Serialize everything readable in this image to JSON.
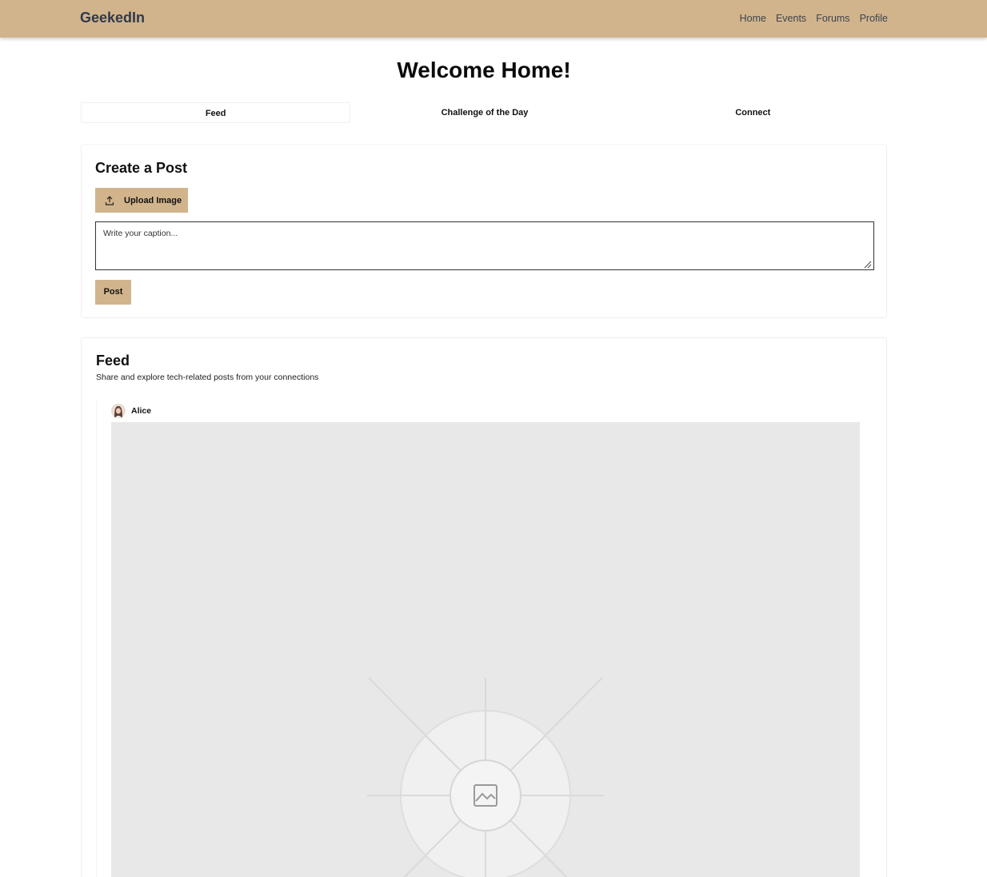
{
  "navbar": {
    "brand": "GeekedIn",
    "links": [
      "Home",
      "Events",
      "Forums",
      "Profile"
    ]
  },
  "page": {
    "heading": "Welcome Home!"
  },
  "tabs": [
    {
      "label": "Feed",
      "active": true
    },
    {
      "label": "Challenge of the Day",
      "active": false
    },
    {
      "label": "Connect",
      "active": false
    }
  ],
  "create_post": {
    "title": "Create a Post",
    "upload_label": "Upload Image",
    "upload_icon": "upload-icon",
    "caption_placeholder": "Write your caption...",
    "post_label": "Post"
  },
  "feed": {
    "title": "Feed",
    "subtitle": "Share and explore tech-related posts from your connections",
    "posts": [
      {
        "author": "Alice",
        "avatar_icon": "avatar",
        "image_icon": "image-placeholder-icon"
      }
    ]
  },
  "colors": {
    "accent": "#d2b48c",
    "brand_text": "#2f3a4a",
    "image_placeholder_bg": "#e8e8e8"
  }
}
